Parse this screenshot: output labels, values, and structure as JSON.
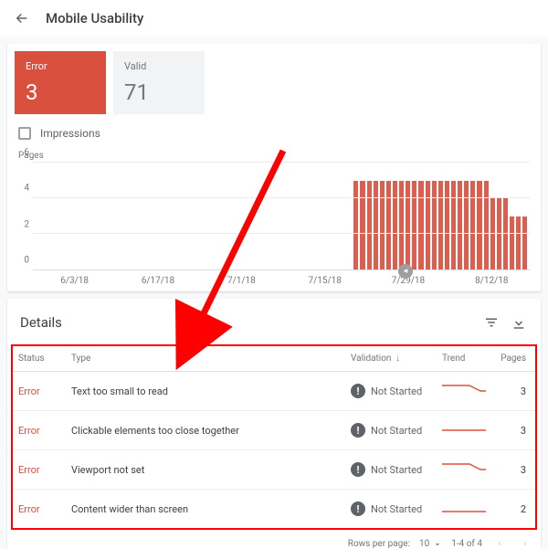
{
  "header": {
    "title": "Mobile Usability"
  },
  "stats": {
    "error_label": "Error",
    "error_value": "3",
    "valid_label": "Valid",
    "valid_value": "71"
  },
  "impressions_label": "Impressions",
  "chart_data": {
    "type": "bar",
    "ylabel": "Pages",
    "y_ticks": [
      0,
      2,
      4,
      6
    ],
    "ylim": [
      0,
      6
    ],
    "x_ticks": [
      "6/3/18",
      "6/17/18",
      "7/1/18",
      "7/15/18",
      "7/29/18",
      "8/12/18"
    ],
    "marker_x_tick": "7/29/18",
    "bars": [
      0,
      0,
      0,
      0,
      0,
      0,
      0,
      0,
      0,
      0,
      0,
      0,
      0,
      0,
      0,
      0,
      0,
      0,
      0,
      0,
      0,
      0,
      0,
      0,
      0,
      0,
      0,
      0,
      0,
      0,
      0,
      0,
      0,
      0,
      0,
      0,
      0,
      0,
      0,
      0,
      0,
      0,
      0,
      0,
      0,
      0,
      0,
      0,
      0,
      5,
      5,
      5,
      5,
      5,
      5,
      5,
      5,
      5,
      5,
      5,
      5,
      5,
      5,
      5,
      5,
      5,
      5,
      5,
      5,
      5,
      4,
      4,
      4,
      3,
      3,
      3
    ]
  },
  "details": {
    "title": "Details",
    "columns": {
      "status": "Status",
      "type": "Type",
      "validation": "Validation",
      "trend": "Trend",
      "pages": "Pages"
    },
    "validation_not_started": "Not Started",
    "status_error": "Error",
    "rows": [
      {
        "type": "Text too small to read",
        "pages": "3",
        "trend": [
          5,
          5,
          5,
          5,
          5,
          5,
          4,
          3,
          3
        ]
      },
      {
        "type": "Clickable elements too close together",
        "pages": "3",
        "trend": [
          3,
          3,
          3,
          3,
          3,
          3,
          3,
          3,
          3
        ]
      },
      {
        "type": "Viewport not set",
        "pages": "3",
        "trend": [
          5,
          5,
          5,
          5,
          5,
          5,
          4,
          3,
          3
        ]
      },
      {
        "type": "Content wider than screen",
        "pages": "2",
        "trend": [
          2,
          2,
          2,
          2,
          2,
          2,
          2,
          2,
          2
        ]
      }
    ]
  },
  "footer": {
    "rows_per_page_label": "Rows per page:",
    "rows_per_page_value": "10",
    "range_label": "1-4 of 4"
  }
}
